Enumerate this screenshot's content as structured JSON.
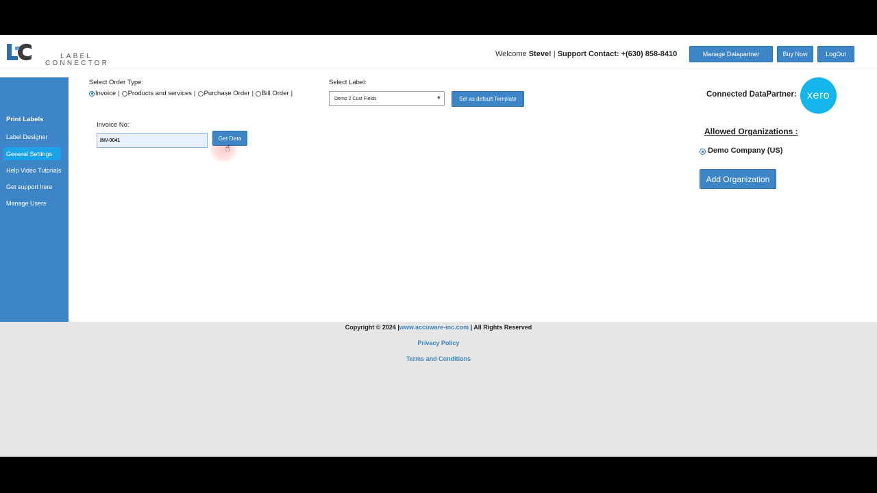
{
  "header": {
    "logo_line1": "LABEL",
    "logo_line2": "CONNECTOR",
    "welcome_prefix": "Welcome ",
    "user_name": "Steve!",
    "separator": " | ",
    "support_contact": "Support Contact: +(630) 858-8410",
    "buttons": {
      "manage_datapartner": "Manage Datapartner",
      "buy_now": "Buy Now",
      "logout": "LogOut"
    }
  },
  "sidebar": {
    "items": [
      {
        "label": "Print Labels"
      },
      {
        "label": "Label Designer"
      },
      {
        "label": "General Settings"
      },
      {
        "label": "Help Video Tutorials"
      },
      {
        "label": "Get support here"
      },
      {
        "label": "Manage Users"
      }
    ],
    "active_index": 2
  },
  "order_type": {
    "label": "Select Order Type:",
    "options": [
      "Invoice",
      "Products and services",
      "Purchase Order",
      "Bill Order"
    ],
    "selected": "Invoice"
  },
  "select_label": {
    "label": "Select Label:",
    "value": "Demo 2 Cust Fields",
    "default_button": "Set as default Template"
  },
  "invoice": {
    "label": "Invoice No:",
    "value": "INV-0041",
    "get_data_button": "Get Data"
  },
  "datapartner": {
    "label": "Connected DataPartner:",
    "logo_text": "xero",
    "color": "#13b5ea"
  },
  "organizations": {
    "title": "Allowed Organizations :",
    "items": [
      "Demo Company (US)"
    ],
    "selected": "Demo Company (US)",
    "add_button": "Add Organization"
  },
  "footer": {
    "copyright_prefix": "Copyright © 2024 |",
    "website": "www.accuware-inc.com",
    "copyright_suffix": " | All Rights Reserved",
    "privacy": "Privacy Policy",
    "terms": "Terms and Conditions"
  },
  "colors": {
    "primary": "#3d85c6",
    "active_nav": "#1aa3e8",
    "footer_bg": "#e6e6e6"
  }
}
